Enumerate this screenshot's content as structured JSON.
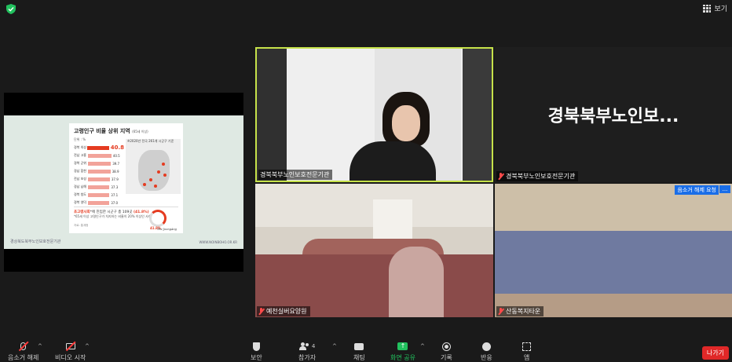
{
  "top_bar": {
    "view_label": "보기"
  },
  "shared_screen": {
    "slide_title": "고령인구 비율 상위 지역",
    "slide_subtitle": "(65세 이상)",
    "unit_label": "단위 : %",
    "map_note": "※2020년 전국 261개 시군구 기준",
    "rows": [
      {
        "region": "경북 의성",
        "value": "40.8",
        "pct": 40.8
      },
      {
        "region": "전남 고흥",
        "value": "40.5",
        "pct": 40.5
      },
      {
        "region": "경북 군위",
        "value": "39.7",
        "pct": 39.7
      },
      {
        "region": "경남 합천",
        "value": "38.9",
        "pct": 38.9
      },
      {
        "region": "전남 보성",
        "value": "37.9",
        "pct": 37.9
      },
      {
        "region": "경남 남해",
        "value": "37.3",
        "pct": 37.3
      },
      {
        "region": "경북 청도",
        "value": "37.1",
        "pct": 37.1
      },
      {
        "region": "경북 영덕",
        "value": "37.0",
        "pct": 37.0
      }
    ],
    "footnote_prefix": "초고령사회",
    "footnote_mid": "*에 진입한 시군구 총 109곳",
    "footnote_highlight": "(41.8%)",
    "footnote_line2": "*65세 이상 고령인구가 차지하는 비율이 20% 이상인 사회",
    "source": "자료: 통계청",
    "gauge_value": "41.8%",
    "gauge_fraction": 0.418,
    "brand": "The JoongAng",
    "footer_left": "경상북도북부노인보호전문기관",
    "footer_right": "WWW.NOINBOHO.OR.KR"
  },
  "tiles": [
    {
      "name": "경북북부노인보호전문기관",
      "muted": false,
      "active_speaker": true
    },
    {
      "name": "경북북부노인보호전문기관",
      "display_text": "경북북부노인보...",
      "muted": true
    },
    {
      "name": "예천실버요양원",
      "muted": true
    },
    {
      "name": "산동복지타운",
      "muted": true,
      "tag": "음소거 해제 요청",
      "more": "..."
    }
  ],
  "toolbar": {
    "unmute": "음소거 해제",
    "video": "비디오 시작",
    "security": "보안",
    "participants": "참가자",
    "participants_count": "4",
    "chat": "채팅",
    "share": "화면 공유",
    "record": "기록",
    "reactions": "반응",
    "apps": "앱",
    "leave": "나가기"
  },
  "colors": {
    "accent_share": "#22c15e",
    "leave_button": "#e02828",
    "active_speaker_border": "#c6e24a",
    "muted_icon": "#ff4b4b",
    "chart_highlight": "#e53b20"
  }
}
